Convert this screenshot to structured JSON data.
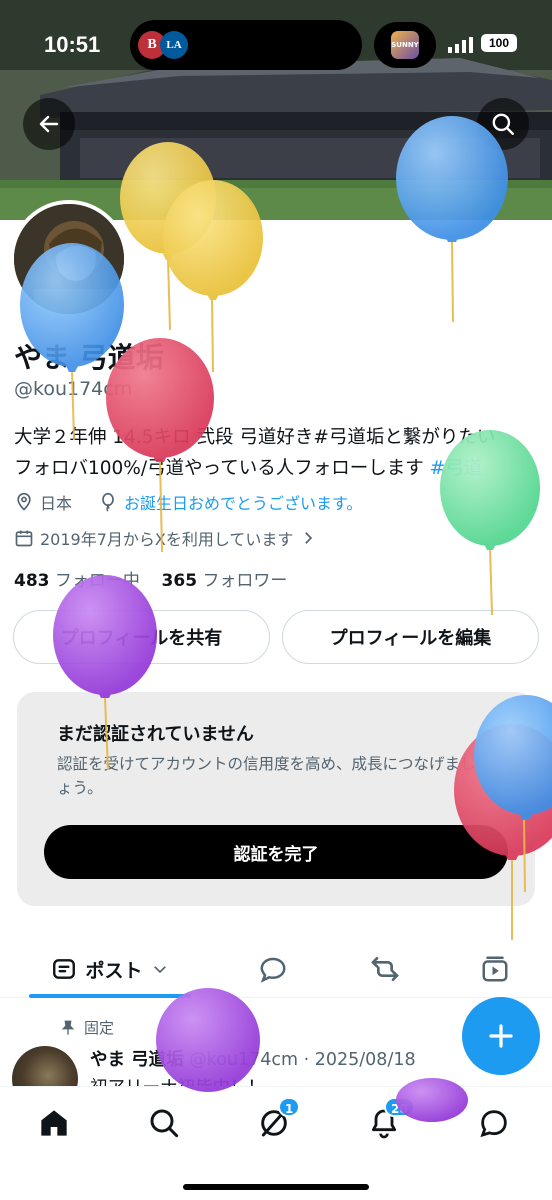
{
  "status_bar": {
    "time": "10:51",
    "battery": "100",
    "team1": "B",
    "team2": "LA",
    "app_icon": "SUNNY"
  },
  "profile": {
    "name": "やま 弓道垢",
    "handle": "@kou174cm",
    "bio": "大学２年伸 14.5キロ 弐段 弓道好き#弓道垢と繋がりたい\nフォロバ100%/弓道やっている人フォローします ",
    "bio_hashtag": "#弓道",
    "location": "日本",
    "birthday": "お誕生日おめでとうございます。",
    "joined": "2019年7月からXを利用しています",
    "following_count": "483",
    "following_label": "フォロー中",
    "followers_count": "365",
    "followers_label": "フォロワー"
  },
  "buttons": {
    "share": "プロフィールを共有",
    "edit": "プロフィールを編集"
  },
  "verification": {
    "title": "まだ認証されていません",
    "description": "認証を受けてアカウントの信用度を高め、成長につなげましょう。",
    "button": "認証を完了"
  },
  "tabs": {
    "posts": "ポスト"
  },
  "pinned_post": {
    "pinned_label": "固定",
    "author": "やま 弓道垢",
    "handle_date": "@kou174cm · 2025/08/18",
    "text": "初アリーナ初皆中！！"
  },
  "bottom_nav": {
    "grok_badge": "1",
    "notifications_badge": "20"
  },
  "colors": {
    "accent": "#1d9bf0",
    "text": "#0f1419",
    "secondary": "#536471"
  },
  "icons": [
    "back-arrow-icon",
    "search-icon",
    "location-icon",
    "balloon-icon",
    "calendar-icon",
    "chevron-right-icon",
    "post-tab-icon",
    "chevron-down-icon",
    "reply-icon",
    "repost-icon",
    "media-icon",
    "pin-icon",
    "plus-icon",
    "home-icon",
    "explore-icon",
    "grok-icon",
    "bell-icon",
    "messages-icon"
  ]
}
